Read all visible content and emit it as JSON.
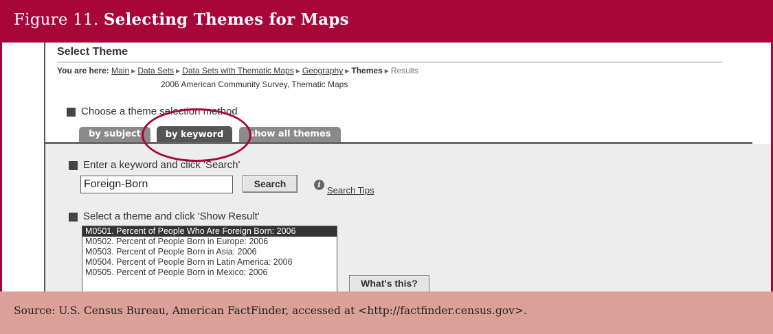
{
  "figure": {
    "label": "Figure 11.",
    "title": "Selecting Themes for Maps"
  },
  "page": {
    "heading": "Select Theme",
    "breadcrumb": {
      "prefix": "You are here:",
      "items": [
        "Main",
        "Data Sets",
        "Data Sets with Thematic Maps",
        "Geography"
      ],
      "current": "Themes",
      "next": "Results"
    },
    "survey_label": "2006 American Community Survey, Thematic Maps"
  },
  "method": {
    "label": "Choose a theme selection method",
    "tabs": [
      {
        "label": "by subject"
      },
      {
        "label": "by keyword"
      },
      {
        "label": "show all themes"
      }
    ],
    "active_tab": "by keyword"
  },
  "keyword_search": {
    "instruction": "Enter a keyword and click 'Search'",
    "value": "Foreign-Born",
    "button_label": "Search",
    "tips_label": "Search Tips"
  },
  "theme_select": {
    "instruction": "Select a theme and click 'Show Result'",
    "options": [
      "M0501. Percent of People Who Are Foreign Born: 2006",
      "M0502. Percent of People Born in Europe: 2006",
      "M0503. Percent of People Born in Asia: 2006",
      "M0504. Percent of People Born in Latin America: 2006",
      "M0505. Percent of People Born in Mexico: 2006"
    ],
    "selected": "M0501. Percent of People Who Are Foreign Born: 2006",
    "whats_this_label": "What's this?"
  },
  "source": "Source: U.S. Census Bureau, American FactFinder, accessed at <http://factfinder.census.gov>.",
  "colors": {
    "header_bg": "#a8063a",
    "source_bg": "#dba199",
    "tab_active": "#555555",
    "tab_inactive": "#8a8a8a",
    "highlight_circle": "#a8063a"
  }
}
